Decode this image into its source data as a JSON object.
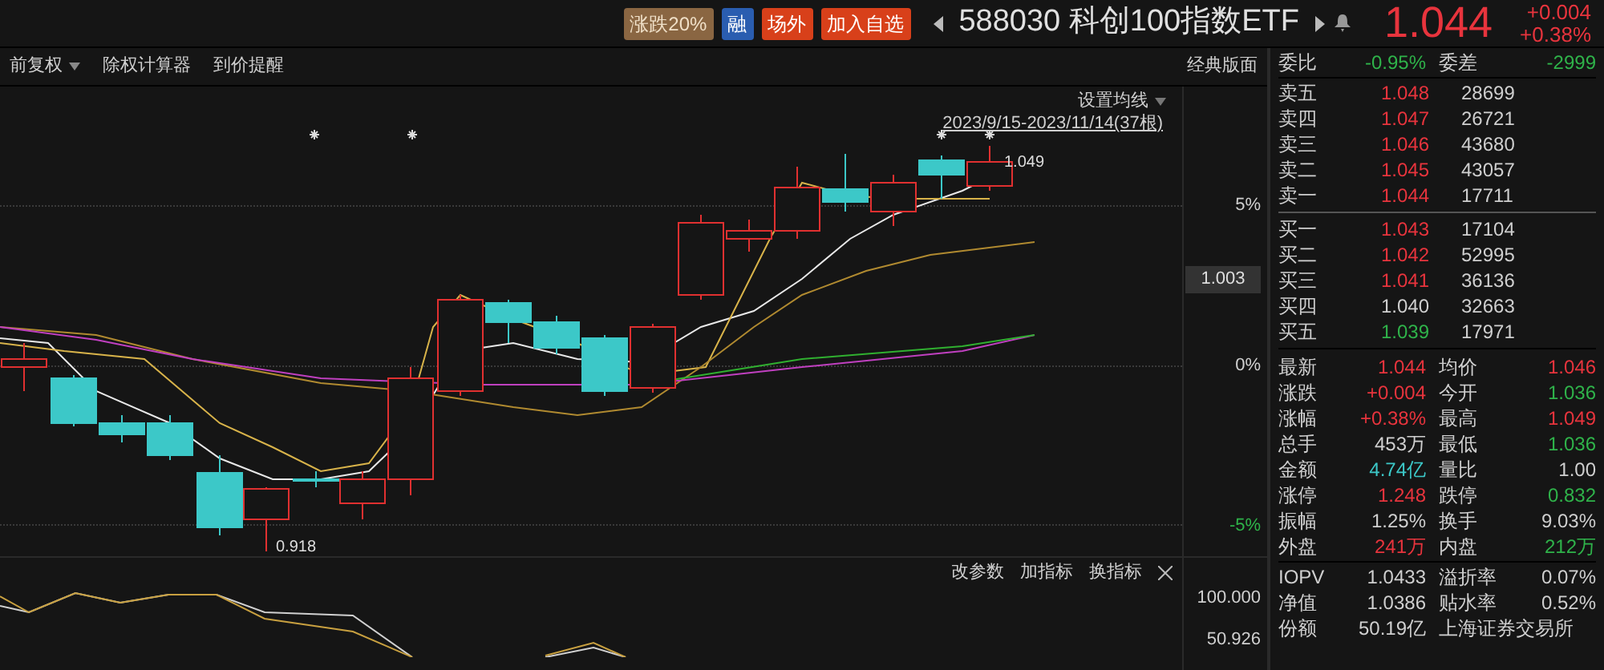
{
  "header": {
    "badges": [
      {
        "text": "涨跌20%",
        "kind": "limit"
      },
      {
        "text": "融",
        "kind": "margin"
      },
      {
        "text": "场外",
        "kind": "otc"
      },
      {
        "text": "加入自选",
        "kind": "watch"
      }
    ],
    "title": "588030 科创100指数ETF",
    "price": "1.044",
    "change": "+0.004",
    "change_pct": "+0.38%",
    "color": "#e8343d"
  },
  "toolbar": {
    "items": [
      {
        "label": "前复权",
        "dropdown": true
      },
      {
        "label": "除权计算器",
        "dropdown": false
      },
      {
        "label": "到价提醒",
        "dropdown": false
      }
    ],
    "layout_button": "经典版面"
  },
  "chart": {
    "ma_settings": "设置均线",
    "range": "2023/9/15-2023/11/14(37根)",
    "high_label": "1.049",
    "low_label": "0.918",
    "axis_labels": [
      {
        "text": "5%",
        "color": "#cfcfcf"
      },
      {
        "text": "0%",
        "color": "#cfcfcf"
      },
      {
        "text": "-5%",
        "color": "#2fb34a"
      }
    ],
    "cursor_price": "1.003"
  },
  "indicator": {
    "buttons": [
      "改参数",
      "加指标",
      "换指标"
    ],
    "axis_labels": [
      "100.000",
      "50.926"
    ]
  },
  "order_book": {
    "summary": [
      {
        "label": "委比",
        "value": "-0.95%",
        "color": "#2fb34a"
      },
      {
        "label": "委差",
        "value": "-2999",
        "color": "#2fb34a"
      }
    ],
    "asks": [
      {
        "label": "卖五",
        "price": "1.048",
        "volume": "28699",
        "color": "#e8343d"
      },
      {
        "label": "卖四",
        "price": "1.047",
        "volume": "26721",
        "color": "#e8343d"
      },
      {
        "label": "卖三",
        "price": "1.046",
        "volume": "43680",
        "color": "#e8343d"
      },
      {
        "label": "卖二",
        "price": "1.045",
        "volume": "43057",
        "color": "#e8343d"
      },
      {
        "label": "卖一",
        "price": "1.044",
        "volume": "17711",
        "color": "#e8343d"
      }
    ],
    "bids": [
      {
        "label": "买一",
        "price": "1.043",
        "volume": "17104",
        "color": "#e8343d"
      },
      {
        "label": "买二",
        "price": "1.042",
        "volume": "52995",
        "color": "#e8343d"
      },
      {
        "label": "买三",
        "price": "1.041",
        "volume": "36136",
        "color": "#e8343d"
      },
      {
        "label": "买四",
        "price": "1.040",
        "volume": "32663",
        "color": "#cfcfcf"
      },
      {
        "label": "买五",
        "price": "1.039",
        "volume": "17971",
        "color": "#2fb34a"
      }
    ]
  },
  "stats": [
    [
      {
        "label": "最新",
        "value": "1.044",
        "color": "#e8343d"
      },
      {
        "label": "均价",
        "value": "1.046",
        "color": "#e8343d"
      }
    ],
    [
      {
        "label": "涨跌",
        "value": "+0.004",
        "color": "#e8343d"
      },
      {
        "label": "今开",
        "value": "1.036",
        "color": "#2fb34a"
      }
    ],
    [
      {
        "label": "涨幅",
        "value": "+0.38%",
        "color": "#e8343d"
      },
      {
        "label": "最高",
        "value": "1.049",
        "color": "#e8343d"
      }
    ],
    [
      {
        "label": "总手",
        "value": "453万",
        "color": "#cfcfcf"
      },
      {
        "label": "最低",
        "value": "1.036",
        "color": "#2fb34a"
      }
    ],
    [
      {
        "label": "金额",
        "value": "4.74亿",
        "color": "#3cc8c8"
      },
      {
        "label": "量比",
        "value": "1.00",
        "color": "#cfcfcf"
      }
    ],
    [
      {
        "label": "涨停",
        "value": "1.248",
        "color": "#e8343d"
      },
      {
        "label": "跌停",
        "value": "0.832",
        "color": "#2fb34a"
      }
    ],
    [
      {
        "label": "振幅",
        "value": "1.25%",
        "color": "#cfcfcf"
      },
      {
        "label": "换手",
        "value": "9.03%",
        "color": "#cfcfcf"
      }
    ],
    [
      {
        "label": "外盘",
        "value": "241万",
        "color": "#e8343d"
      },
      {
        "label": "内盘",
        "value": "212万",
        "color": "#2fb34a"
      }
    ]
  ],
  "fund": [
    [
      {
        "label": "IOPV",
        "value": "1.0433"
      },
      {
        "label": "溢折率",
        "value": "0.07%"
      }
    ],
    [
      {
        "label": "净值",
        "value": "1.0386"
      },
      {
        "label": "贴水率",
        "value": "0.52%"
      }
    ],
    [
      {
        "label": "份额",
        "value": "50.19亿"
      },
      {
        "label": "上海证券交易所"
      }
    ]
  ]
}
